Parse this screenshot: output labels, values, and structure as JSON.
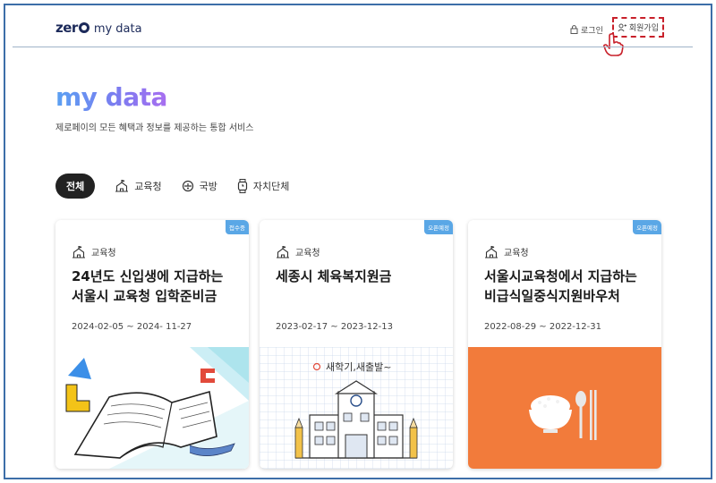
{
  "header": {
    "logo_word": "zer",
    "logo_suffix": "my data",
    "login_label": "로그인",
    "signup_label": "회원가입"
  },
  "hero": {
    "title": "my data",
    "subtitle": "제로페이의 모든 혜택과 정보를 제공하는 통합 서비스"
  },
  "tabs": [
    {
      "label": "전체",
      "icon": null,
      "active": true
    },
    {
      "label": "교육청",
      "icon": "school-icon",
      "active": false
    },
    {
      "label": "국방",
      "icon": "helmet-icon",
      "active": false
    },
    {
      "label": "자치단체",
      "icon": "watch-icon",
      "active": false
    }
  ],
  "cards": [
    {
      "badge": "접수중",
      "category": "교육청",
      "title_line1": "24년도 신입생에 지급하는",
      "title_line2": "서울시 교육청 입학준비금",
      "period": "2024-02-05 ~ 2024- 11-27",
      "art": "open-book-illustration"
    },
    {
      "badge": "오픈예정",
      "category": "교육청",
      "title_line1": "세종시 체육복지원금",
      "title_line2": "",
      "period": "2023-02-17 ~ 2023-12-13",
      "art": "school-building-illustration",
      "art_text": "새학기,새출발~"
    },
    {
      "badge": "오픈예정",
      "category": "교육청",
      "title_line1": "서울시교육청에서 지급하는",
      "title_line2": "비급식일중식지원바우처",
      "period": "2022-08-29 ~ 2022-12-31",
      "art": "rice-bowl-illustration"
    }
  ],
  "colors": {
    "frame": "#3d6ea8",
    "badge": "#5aa7e6",
    "orange": "#f27b3b",
    "signup_border": "#c8202a"
  }
}
